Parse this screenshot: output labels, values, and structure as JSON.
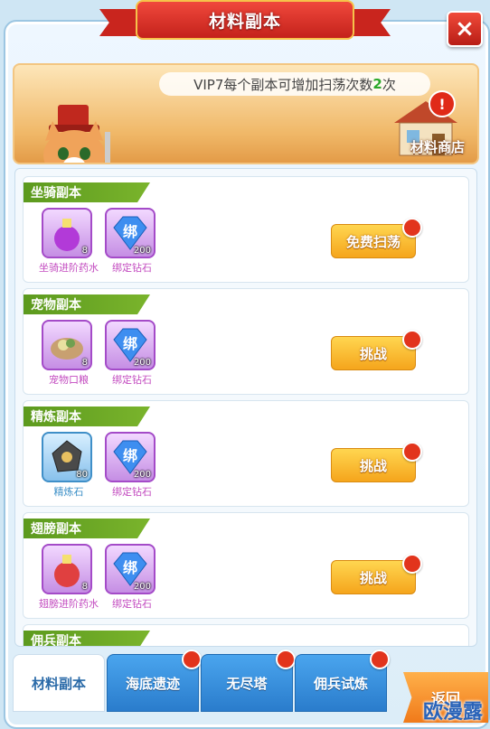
{
  "title": "材料副本",
  "banner": {
    "vip_prefix": "VIP7每个副本可增加扫荡次数",
    "vip_count": "2",
    "vip_suffix": "次",
    "shop_label": "材料商店",
    "shop_alert": "!"
  },
  "dungeons": [
    {
      "name": "坐骑副本",
      "action": "免费扫荡",
      "rewards": [
        {
          "name": "坐骑进阶药水",
          "count": "8",
          "icon": "potion-icon"
        },
        {
          "name": "绑定钻石",
          "count": "200",
          "icon": "diamond-icon"
        }
      ]
    },
    {
      "name": "宠物副本",
      "action": "挑战",
      "rewards": [
        {
          "name": "宠物口粮",
          "count": "8",
          "icon": "food-icon"
        },
        {
          "name": "绑定钻石",
          "count": "200",
          "icon": "diamond-icon"
        }
      ]
    },
    {
      "name": "精炼副本",
      "action": "挑战",
      "rewards": [
        {
          "name": "精炼石",
          "count": "80",
          "icon": "stone-icon"
        },
        {
          "name": "绑定钻石",
          "count": "200",
          "icon": "diamond-icon"
        }
      ]
    },
    {
      "name": "翅膀副本",
      "action": "挑战",
      "rewards": [
        {
          "name": "翅膀进阶药水",
          "count": "8",
          "icon": "potion-icon"
        },
        {
          "name": "绑定钻石",
          "count": "200",
          "icon": "diamond-icon"
        }
      ]
    },
    {
      "name": "佣兵副本"
    }
  ],
  "diamond_glyph": "绑",
  "tabs": [
    "材料副本",
    "海底遗迹",
    "无尽塔",
    "佣兵试炼"
  ],
  "back_label": "返回",
  "watermark": "欧漫露",
  "close_glyph": "×"
}
